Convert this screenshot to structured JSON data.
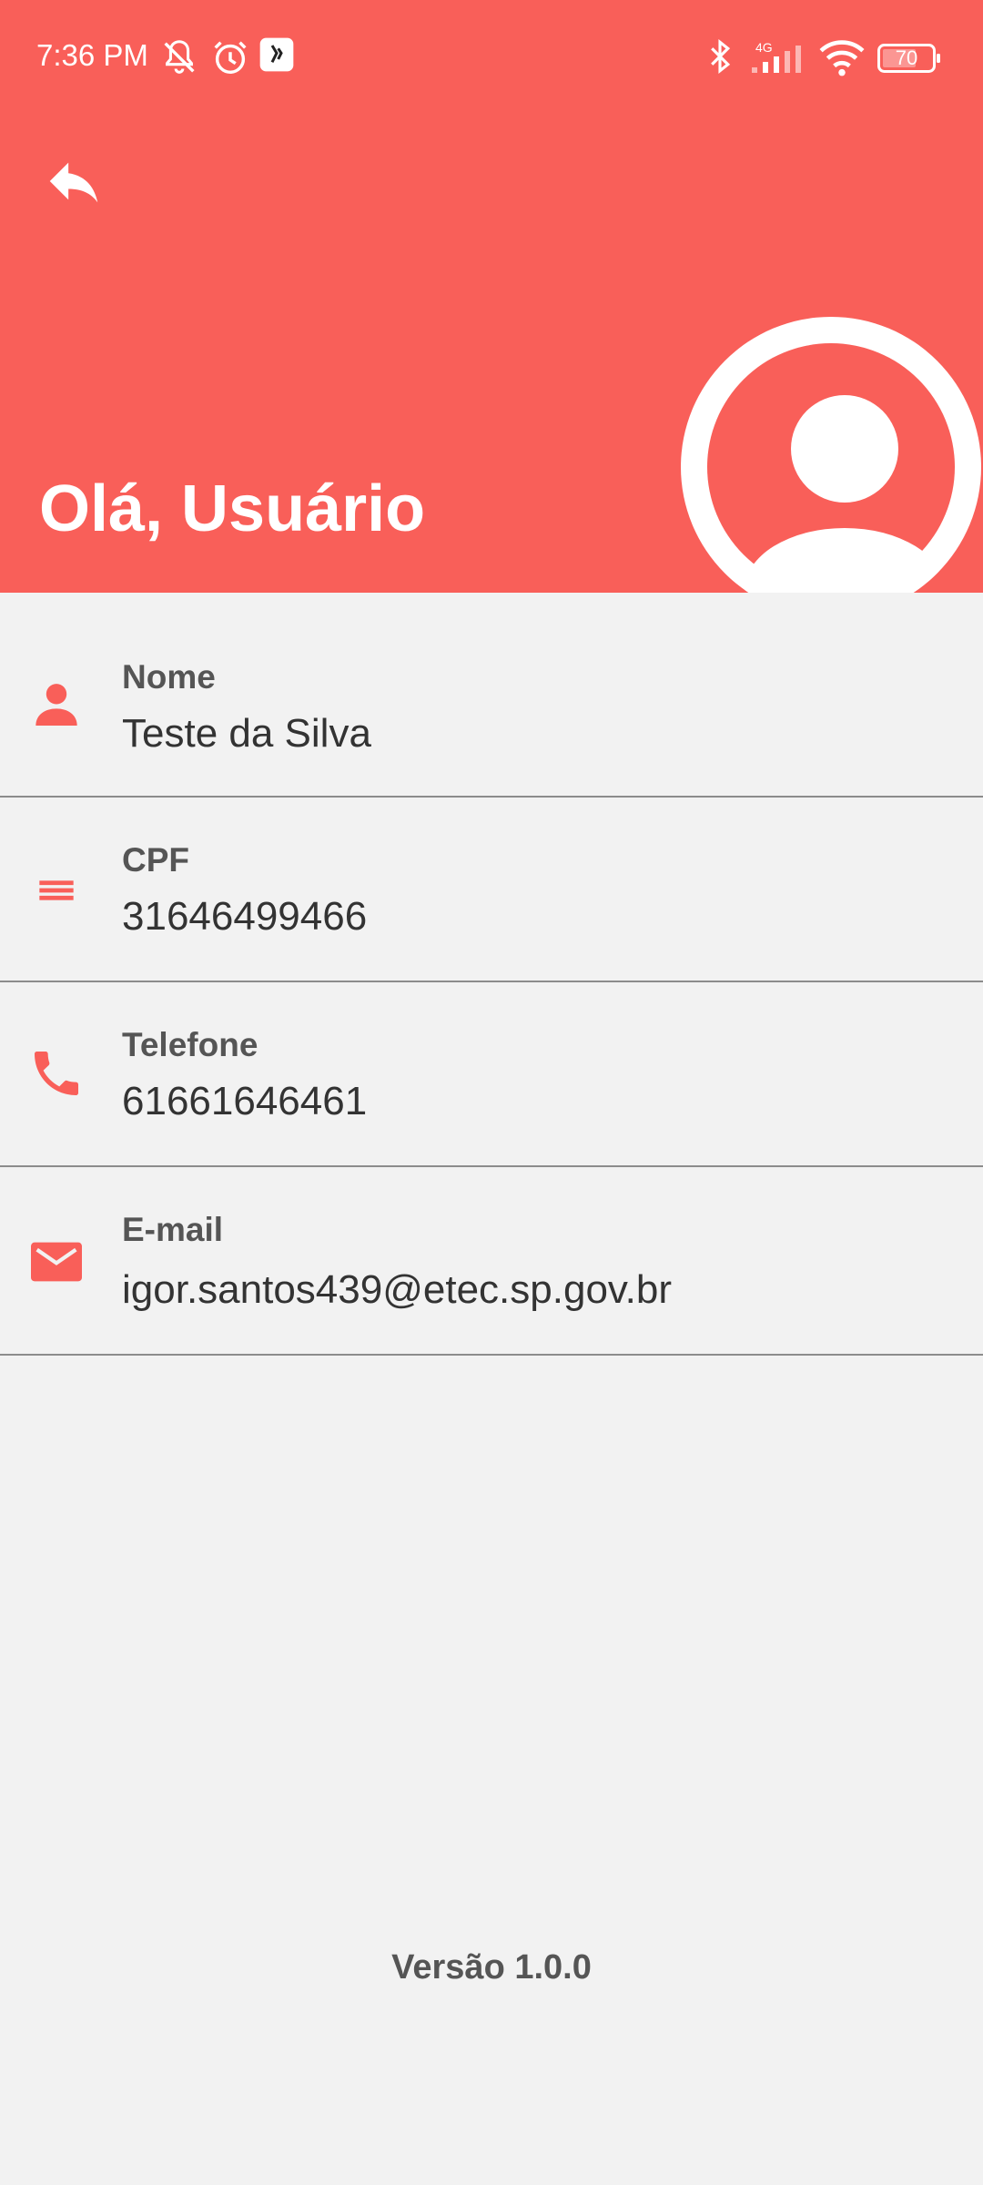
{
  "status_bar": {
    "time": "7:36 PM",
    "network_type": "4G",
    "battery_level": "70",
    "icons": [
      "bell-muted-icon",
      "alarm-clock-icon",
      "app-notification-icon",
      "bluetooth-icon",
      "cell-signal-icon",
      "wifi-icon",
      "battery-icon"
    ]
  },
  "header": {
    "greeting": "Olá, Usuário",
    "background_color": "#f95f59",
    "back_icon": "reply-arrow-icon",
    "avatar_icon": "person-avatar-icon"
  },
  "fields": [
    {
      "label": "Nome",
      "value": "Teste da Silva",
      "icon": "person-icon"
    },
    {
      "label": "CPF",
      "value": "31646499466",
      "icon": "menu-lines-icon"
    },
    {
      "label": "Telefone",
      "value": "61661646461",
      "icon": "phone-icon"
    },
    {
      "label": "E-mail",
      "value": "igor.santos439@etec.sp.gov.br",
      "icon": "mail-icon"
    }
  ],
  "footer": {
    "version": "Versão 1.0.0"
  },
  "colors": {
    "accent": "#f95f59",
    "background": "#f2f2f2",
    "divider": "#8c8c8c"
  }
}
